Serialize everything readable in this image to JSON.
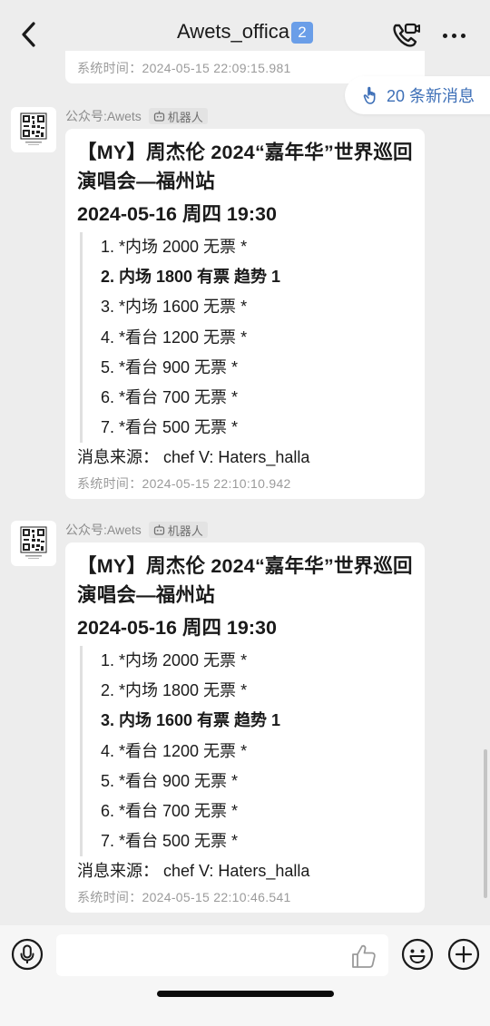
{
  "header": {
    "title": "Awets_offica",
    "badge": "2"
  },
  "top_partial": {
    "sys_time": "系统时间：2024-05-15 22:09:15.981"
  },
  "new_messages": {
    "label": "20 条新消息"
  },
  "messages": [
    {
      "sender": "公众号:Awets",
      "bot_tag": "机器人",
      "title": "【MY】周杰伦 2024“嘉年华”世界巡回演唱会—福州站",
      "date": "2024-05-16 周四 19:30",
      "tickets": [
        "1. *内场 2000 无票 *",
        "2. 内场 1800 有票 趋势 1",
        "3. *内场 1600 无票 *",
        "4. *看台 1200 无票 *",
        "5. *看台 900 无票 *",
        "6. *看台 700 无票 *",
        "7. *看台 500 无票 *"
      ],
      "source": "消息来源： chef V: Haters_halla",
      "sys_time": "系统时间：2024-05-15 22:10:10.942"
    },
    {
      "sender": "公众号:Awets",
      "bot_tag": "机器人",
      "title": "【MY】周杰伦 2024“嘉年华”世界巡回演唱会—福州站",
      "date": "2024-05-16 周四 19:30",
      "tickets": [
        "1. *内场 2000 无票 *",
        "2. *内场 1800 无票 *",
        "3. 内场 1600 有票 趋势 1",
        "4. *看台 1200 无票 *",
        "5. *看台 900 无票 *",
        "6. *看台 700 无票 *",
        "7. *看台 500 无票 *"
      ],
      "source": "消息来源： chef V: Haters_halla",
      "sys_time": "系统时间：2024-05-15 22:10:46.541"
    }
  ],
  "input_bar": {
    "placeholder": ""
  },
  "icons": {
    "back": "chevron-left-icon",
    "call": "video-call-icon",
    "more": "more-dots-icon",
    "new_msgs": "pointing-hand-icon",
    "bot": "robot-icon",
    "voice": "microphone-icon",
    "like": "thumbs-up-icon",
    "emoji": "smiley-icon",
    "plus": "plus-icon"
  },
  "colors": {
    "background": "#ededed",
    "bubble": "#ffffff",
    "accent": "#3d6fb7",
    "badge": "#6a9ee8"
  }
}
